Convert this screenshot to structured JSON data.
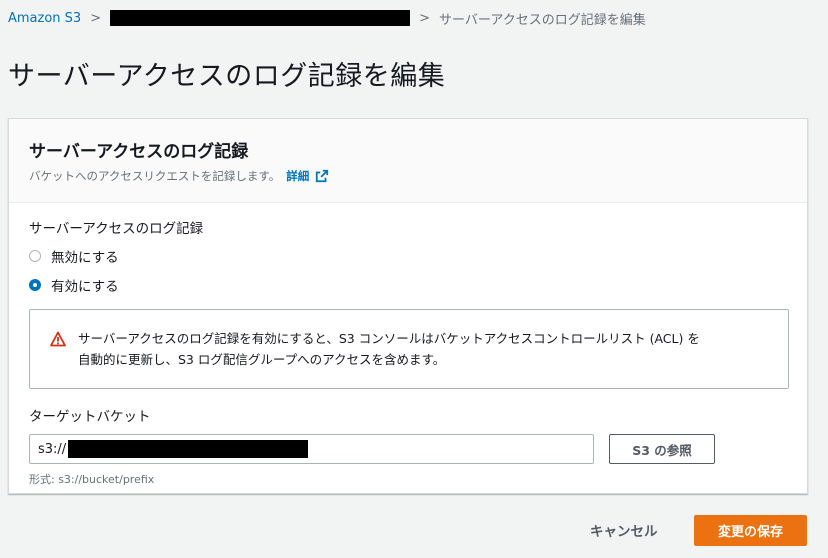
{
  "breadcrumb": {
    "root": "Amazon S3",
    "current": "サーバーアクセスのログ記録を編集"
  },
  "page": {
    "title": "サーバーアクセスのログ記録を編集"
  },
  "panel": {
    "title": "サーバーアクセスのログ記録",
    "description": "バケットへのアクセスリクエストを記録します。",
    "info_link": "詳細"
  },
  "logging": {
    "label": "サーバーアクセスのログ記録",
    "options": [
      {
        "label": "無効にする",
        "selected": false
      },
      {
        "label": "有効にする",
        "selected": true
      }
    ]
  },
  "alert": {
    "line1": "サーバーアクセスのログ記録を有効にすると、S3 コンソールはバケットアクセスコントロールリスト (ACL) を",
    "line2": "自動的に更新し、S3 ログ配信グループへのアクセスを含めます。",
    "icon": "warning-icon",
    "color": "#d13212"
  },
  "target": {
    "label": "ターゲットバケット",
    "prefix": "s3://",
    "browse_label": "S3 の参照",
    "hint": "形式: s3://bucket/prefix"
  },
  "footer": {
    "cancel_label": "キャンセル",
    "save_label": "変更の保存"
  },
  "colors": {
    "accent": "#ec7211",
    "link": "#0073bb",
    "radio_selected": "#0073bb"
  }
}
